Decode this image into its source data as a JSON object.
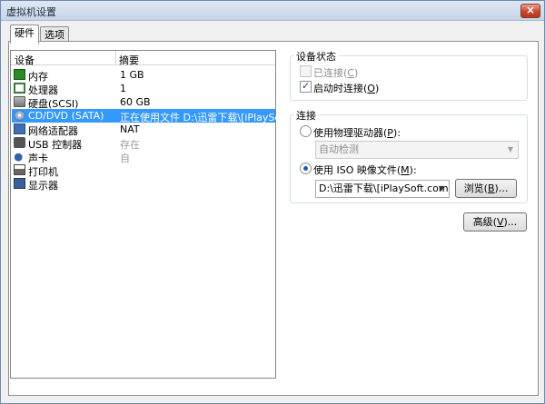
{
  "window": {
    "title": "虚拟机设置",
    "close_icon": "×"
  },
  "tabs": [
    {
      "label": "硬件"
    },
    {
      "label": "选项"
    }
  ],
  "device_list": {
    "headers": {
      "device": "设备",
      "summary": "摘要"
    },
    "rows": [
      {
        "name": "内存",
        "summary": "1 GB",
        "icon": "memory-icon"
      },
      {
        "name": "处理器",
        "summary": "1",
        "icon": "processor-icon"
      },
      {
        "name": "硬盘(SCSI)",
        "summary": "60 GB",
        "icon": "harddisk-icon"
      },
      {
        "name": "CD/DVD (SATA)",
        "summary": "正在使用文件 D:\\迅雷下载\\[iPlaySof...",
        "icon": "cdrom-icon",
        "selected": true
      },
      {
        "name": "网络适配器",
        "summary": "NAT",
        "icon": "network-adapter-icon"
      },
      {
        "name": "USB 控制器",
        "summary": "存在",
        "icon": "usb-icon"
      },
      {
        "name": "声卡",
        "summary": "自",
        "icon": "sound-card-icon"
      },
      {
        "name": "打印机",
        "summary": "",
        "icon": "printer-icon"
      },
      {
        "name": "显示器",
        "summary": "",
        "icon": "display-icon"
      }
    ]
  },
  "device_status": {
    "title": "设备状态",
    "connected": {
      "label": "已连接(",
      "key": "C",
      "suffix": ")",
      "checked": false,
      "disabled": true
    },
    "connect_at_power_on": {
      "label": "启动时连接(",
      "key": "O",
      "suffix": ")",
      "checked": true
    }
  },
  "connection": {
    "title": "连接",
    "physical_drive": {
      "label": "使用物理驱动器(",
      "key": "P",
      "suffix": "):",
      "selected": false
    },
    "drive_select": {
      "value": "自动检测",
      "disabled": true
    },
    "iso_image": {
      "label": "使用 ISO 映像文件(",
      "key": "M",
      "suffix": "):",
      "selected": true
    },
    "iso_path": {
      "value": "D:\\迅雷下载\\[iPlaySoft.com]"
    },
    "browse_button": {
      "label": "浏览(",
      "key": "B",
      "suffix": ")..."
    }
  },
  "advanced_button": {
    "label": "高级(",
    "key": "V",
    "suffix": ")..."
  },
  "icons": {
    "dropdown": "▼",
    "checkmark": "✓"
  },
  "colors": {
    "selection": "#3399ff",
    "panel_bg": "#f0f0f0"
  }
}
